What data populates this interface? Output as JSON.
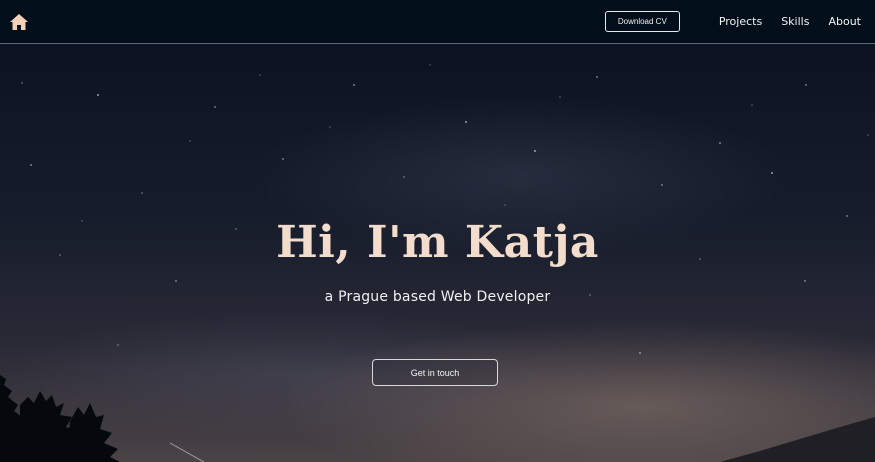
{
  "navbar": {
    "home_icon": "home-icon",
    "download_cv_label": "Download CV",
    "links": [
      "Projects",
      "Skills",
      "About"
    ]
  },
  "hero": {
    "title": "Hi, I'm Katja",
    "subtitle": "a Prague based Web Developer",
    "cta_label": "Get in touch"
  },
  "colors": {
    "navbar_bg": "#020e19",
    "title_color": "#f3dccb",
    "home_icon_color": "#f3d1b8"
  }
}
